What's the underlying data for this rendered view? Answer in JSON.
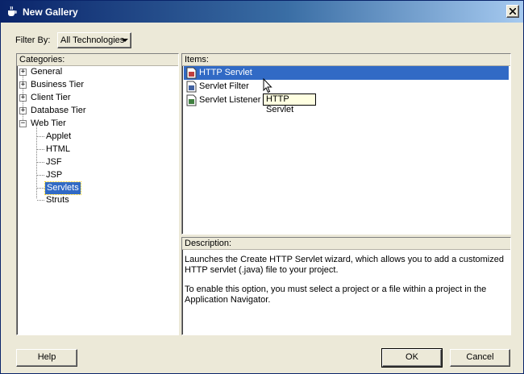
{
  "window": {
    "title": "New Gallery"
  },
  "filter": {
    "label": "Filter By:",
    "value": "All Technologies"
  },
  "categories": {
    "header": "Categories:",
    "top": [
      "General",
      "Business Tier",
      "Client Tier",
      "Database Tier",
      "Web Tier"
    ],
    "web_children": [
      "Applet",
      "HTML",
      "JSF",
      "JSP",
      "Servlets",
      "Struts"
    ],
    "selected": "Servlets"
  },
  "items": {
    "header": "Items:",
    "list": [
      "HTTP Servlet",
      "Servlet Filter",
      "Servlet Listener"
    ],
    "selected": "HTTP Servlet",
    "tooltip": "HTTP Servlet"
  },
  "description": {
    "header": "Description:",
    "p1": "Launches the Create HTTP Servlet wizard, which allows you to add a customized HTTP servlet (.java) file to your project.",
    "p2": "To enable this option, you must select a project or a file within a project in the Application Navigator."
  },
  "buttons": {
    "help": "Help",
    "ok": "OK",
    "cancel": "Cancel"
  },
  "colors": {
    "selection": "#316ac5",
    "titlebar": "#0a246a",
    "tooltip_bg": "#ffffe1"
  }
}
